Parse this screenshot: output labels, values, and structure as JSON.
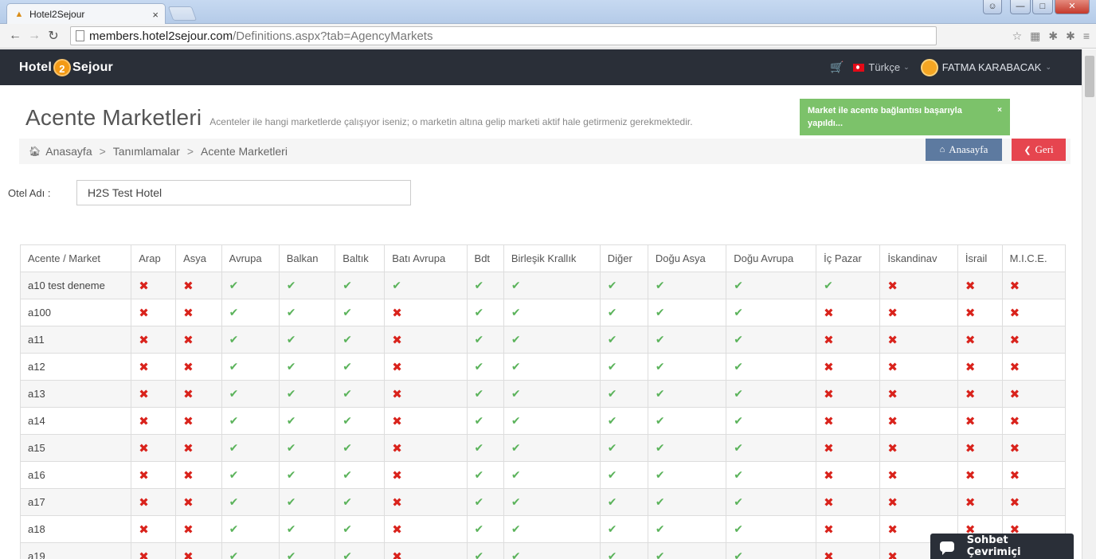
{
  "browser": {
    "tab_title": "Hotel2Sejour",
    "tab_close": "×",
    "url_host": "members.hotel2sejour.com",
    "url_path": "/Definitions.aspx?tab=AgencyMarkets"
  },
  "header": {
    "logo_left": "Hotel",
    "logo_badge": "2",
    "logo_right": "Sejour",
    "language": "Türkçe",
    "user_name": "FATMA KARABACAK"
  },
  "page": {
    "title": "Acente Marketleri",
    "description": "Acenteler ile hangi marketlerde çalışıyor iseniz; o marketin altına gelip marketi aktif hale getirmeniz gerekmektedir."
  },
  "toast": {
    "message": "Market ile acente bağlantısı başarıyla yapıldı...",
    "close": "×"
  },
  "breadcrumb": {
    "items": [
      "Anasayfa",
      "Tanımlamalar",
      "Acente Marketleri"
    ],
    "separator": ">"
  },
  "buttons": {
    "home": "Anasayfa",
    "back": "Geri"
  },
  "form": {
    "hotel_label": "Otel Adı :",
    "hotel_value": "H2S Test Hotel"
  },
  "table": {
    "headers": [
      "Acente / Market",
      "Arap",
      "Asya",
      "Avrupa",
      "Balkan",
      "Baltık",
      "Batı Avrupa",
      "Bdt",
      "Birleşik Krallık",
      "Diğer",
      "Doğu Asya",
      "Doğu Avrupa",
      "İç Pazar",
      "İskandinav",
      "İsrail",
      "M.I.C.E."
    ],
    "rows": [
      {
        "name": "a10 test deneme",
        "values": [
          0,
          0,
          1,
          1,
          1,
          1,
          1,
          1,
          1,
          1,
          1,
          1,
          0,
          0,
          0
        ]
      },
      {
        "name": "a100",
        "values": [
          0,
          0,
          1,
          1,
          1,
          0,
          1,
          1,
          1,
          1,
          1,
          0,
          0,
          0,
          0
        ]
      },
      {
        "name": "a11",
        "values": [
          0,
          0,
          1,
          1,
          1,
          0,
          1,
          1,
          1,
          1,
          1,
          0,
          0,
          0,
          0
        ]
      },
      {
        "name": "a12",
        "values": [
          0,
          0,
          1,
          1,
          1,
          0,
          1,
          1,
          1,
          1,
          1,
          0,
          0,
          0,
          0
        ]
      },
      {
        "name": "a13",
        "values": [
          0,
          0,
          1,
          1,
          1,
          0,
          1,
          1,
          1,
          1,
          1,
          0,
          0,
          0,
          0
        ]
      },
      {
        "name": "a14",
        "values": [
          0,
          0,
          1,
          1,
          1,
          0,
          1,
          1,
          1,
          1,
          1,
          0,
          0,
          0,
          0
        ]
      },
      {
        "name": "a15",
        "values": [
          0,
          0,
          1,
          1,
          1,
          0,
          1,
          1,
          1,
          1,
          1,
          0,
          0,
          0,
          0
        ]
      },
      {
        "name": "a16",
        "values": [
          0,
          0,
          1,
          1,
          1,
          0,
          1,
          1,
          1,
          1,
          1,
          0,
          0,
          0,
          0
        ]
      },
      {
        "name": "a17",
        "values": [
          0,
          0,
          1,
          1,
          1,
          0,
          1,
          1,
          1,
          1,
          1,
          0,
          0,
          0,
          0
        ]
      },
      {
        "name": "a18",
        "values": [
          0,
          0,
          1,
          1,
          1,
          0,
          1,
          1,
          1,
          1,
          1,
          0,
          0,
          0,
          0
        ]
      },
      {
        "name": "a19",
        "values": [
          0,
          0,
          1,
          1,
          1,
          0,
          1,
          1,
          1,
          1,
          1,
          0,
          0,
          0,
          0
        ]
      }
    ]
  },
  "chat": {
    "label": "Sohbet Çevrimiçi"
  },
  "colors": {
    "header_bg": "#2a2f38",
    "toast_bg": "#7cc26a",
    "btn_home": "#5d7aa0",
    "btn_back": "#e6454f",
    "check": "#5bb35b",
    "cross": "#d9231c"
  }
}
